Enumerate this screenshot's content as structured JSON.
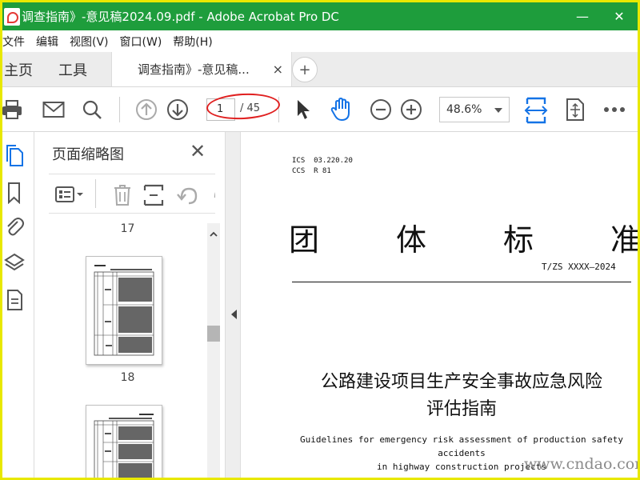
{
  "window": {
    "title": "调查指南》-意见稿2024.09.pdf - Adobe Acrobat Pro DC",
    "minimize": "—",
    "close": "✕"
  },
  "menu": [
    "文件",
    "编辑",
    "视图(V)",
    "窗口(W)",
    "帮助(H)"
  ],
  "tabs": {
    "home": "主页",
    "tools": "工具",
    "document": "调查指南》-意见稿...",
    "close": "×",
    "new_tab": "+"
  },
  "toolbar": {
    "current_page": "1",
    "total_pages": "/ 45",
    "zoom": "48.6%"
  },
  "thumbnail_panel": {
    "title": "页面缩略图",
    "close": "✕",
    "page_labels": [
      "17",
      "18"
    ]
  },
  "document": {
    "ics": "ICS  03.220.20",
    "ccs": "CCS  R 81",
    "standard_title": [
      "团",
      "体",
      "标",
      "准"
    ],
    "standard_code": "T/ZS XXXX—2024",
    "title_zh_line1": "公路建设项目生产安全事故应急风险",
    "title_zh_line2": "评估指南",
    "title_en_line1": "Guidelines for emergency risk assessment of production safety accidents",
    "title_en_line2": "in highway construction projects"
  },
  "watermark": "www.cndao.com",
  "colors": {
    "titlebar": "#1e9d3c",
    "accent_blue": "#1473e6",
    "annotation_red": "#e02020",
    "frame": "#e8e800"
  },
  "icons": {
    "toolbar": [
      "print-icon",
      "email-icon",
      "search-icon",
      "previous-page-icon",
      "next-page-icon",
      "select-cursor-icon",
      "hand-tool-icon",
      "zoom-out-icon",
      "zoom-in-icon",
      "fit-width-icon",
      "full-screen-icon",
      "more-tools-icon"
    ],
    "left_rail": [
      "page-thumbnails-icon",
      "bookmarks-icon",
      "attachments-icon",
      "layers-icon",
      "tags-icon"
    ],
    "panel_toolbar": [
      "thumbnail-options-icon",
      "delete-page-icon",
      "insert-page-icon",
      "rotate-left-icon"
    ]
  }
}
